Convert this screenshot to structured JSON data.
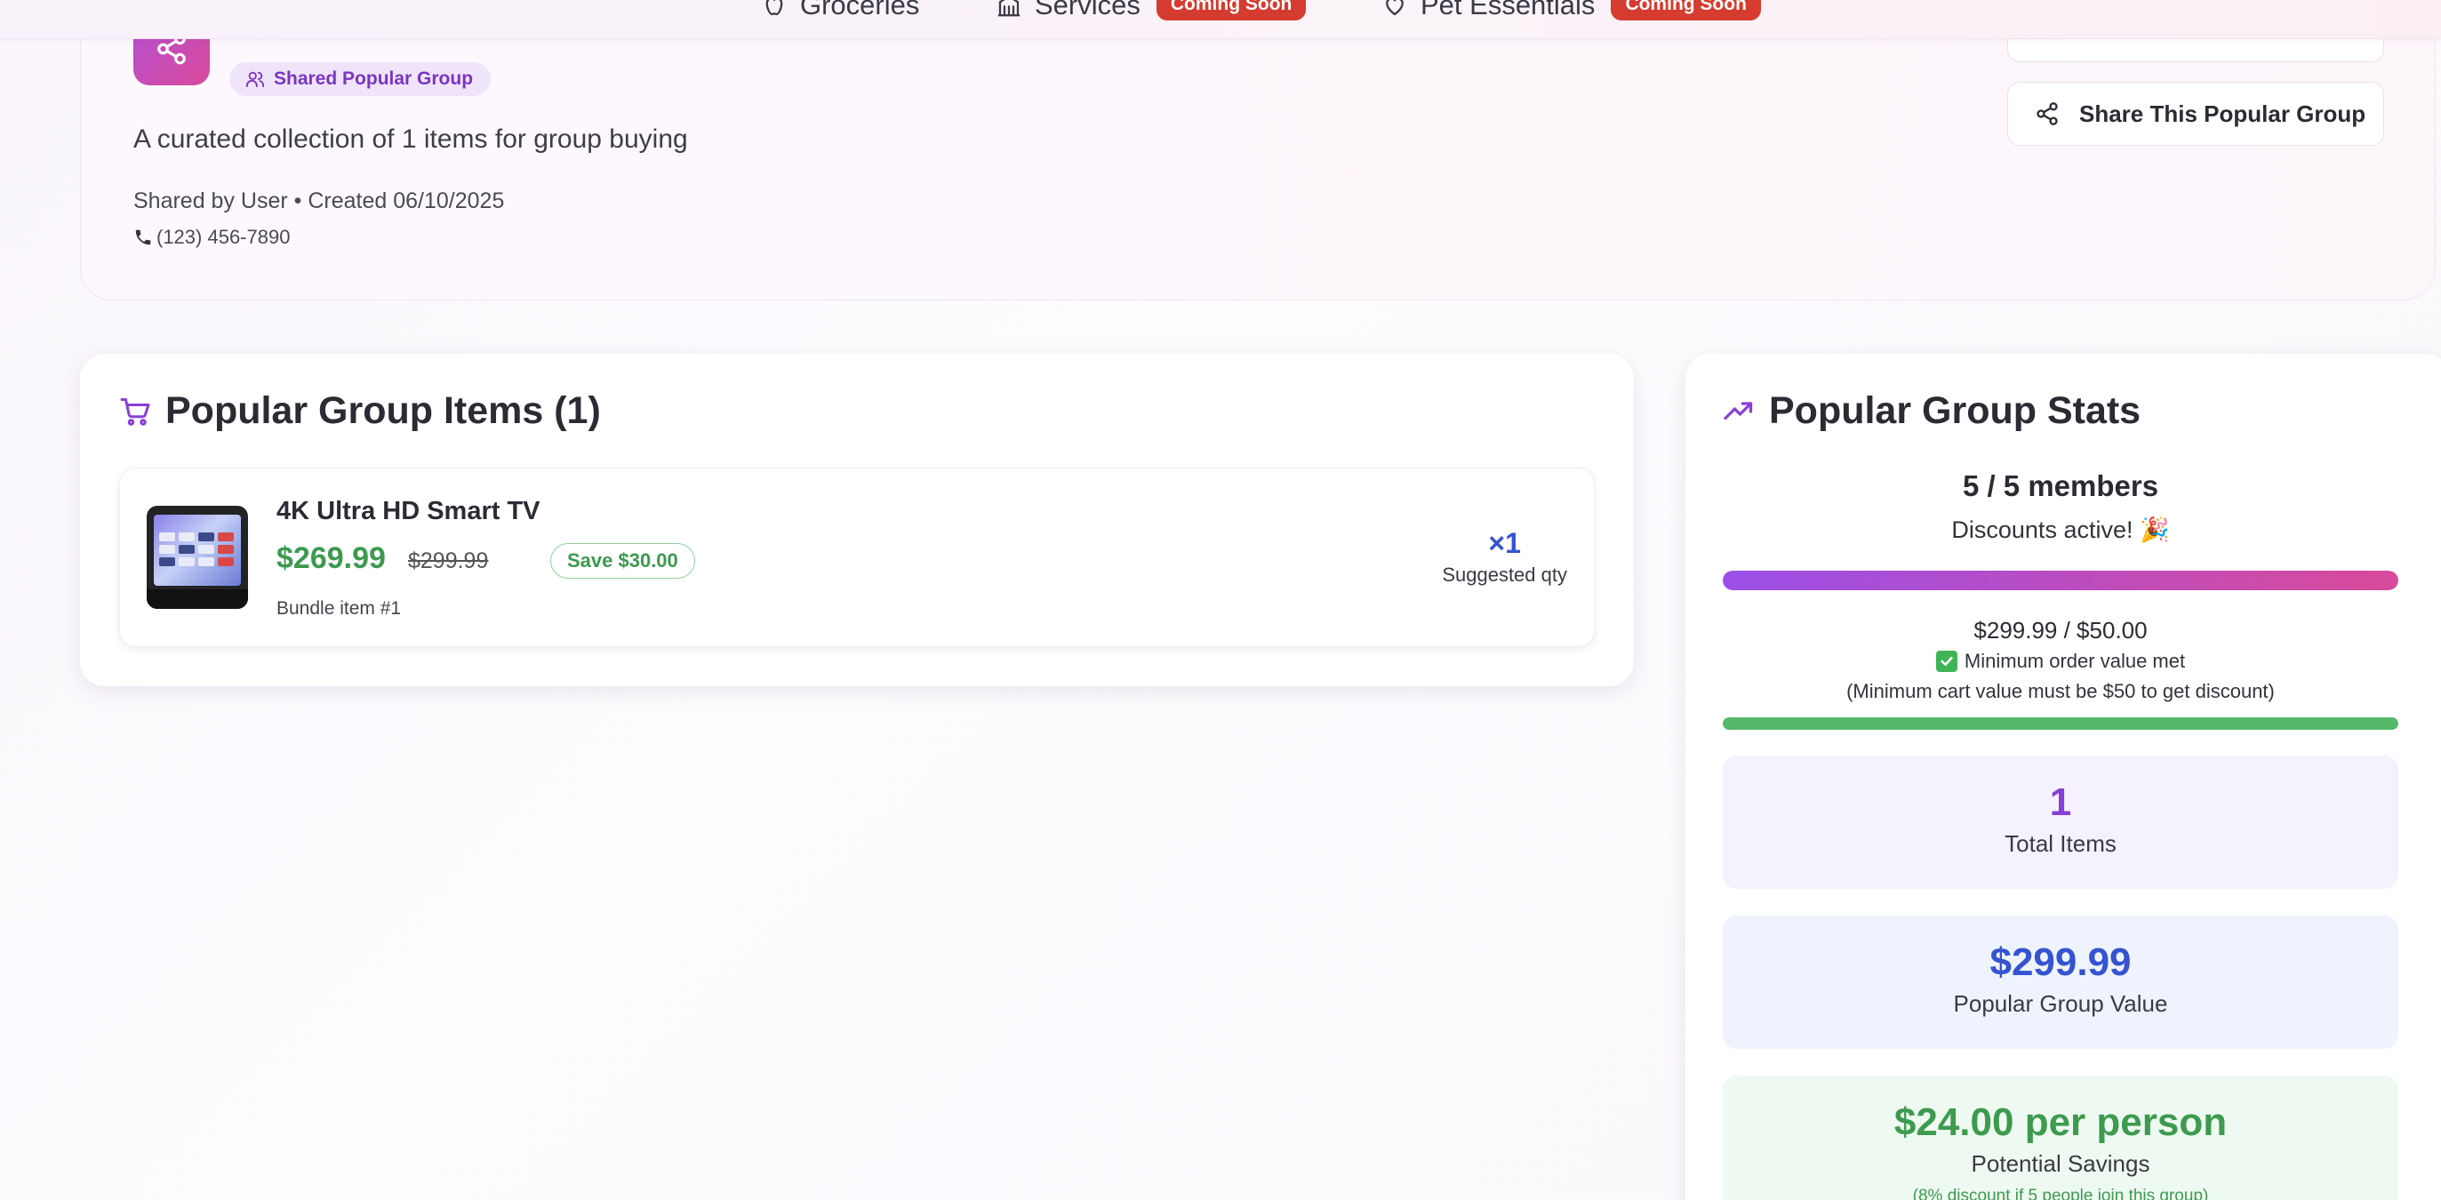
{
  "nav": {
    "items": [
      {
        "label": "Groceries",
        "icon": "apple-icon",
        "badge": ""
      },
      {
        "label": "Services",
        "icon": "building-icon",
        "badge": "Coming Soon"
      },
      {
        "label": "Pet Essentials",
        "icon": "heart-icon",
        "badge": "Coming Soon"
      }
    ]
  },
  "header": {
    "badge_label": "Shared Popular Group",
    "description": "A curated collection of 1 items for group buying",
    "meta": "Shared by User • Created 06/10/2025",
    "phone": "(123) 456-7890",
    "share_button_label": "Share This Popular Group"
  },
  "items_panel": {
    "title": "Popular Group Items (1)",
    "items": [
      {
        "name": "4K Ultra HD Smart TV",
        "price": "$269.99",
        "original_price": "$299.99",
        "savings": "Save $30.00",
        "bundle_label": "Bundle item #1",
        "qty": "×1",
        "qty_label": "Suggested qty"
      }
    ]
  },
  "stats_panel": {
    "title": "Popular Group Stats",
    "members": "5 / 5 members",
    "discount_status": "Discounts active! 🎉",
    "members_progress": 1.0,
    "order_value": "$299.99 / $50.00",
    "min_met": "Minimum order value met",
    "min_note": "(Minimum cart value must be $50 to get discount)",
    "order_progress": 1.0,
    "total_items": "1",
    "total_items_label": "Total Items",
    "group_value": "$299.99",
    "group_value_label": "Popular Group Value",
    "savings_per_person": "$24.00 per person",
    "savings_label": "Potential Savings",
    "savings_note": "(8% discount if 5 people join this group)"
  },
  "colors": {
    "brand_purple": "#8440d6",
    "brand_pink": "#d94a9a",
    "price_green": "#3d9a4f",
    "accent_blue": "#3553d1",
    "badge_red": "#d63b2f"
  }
}
